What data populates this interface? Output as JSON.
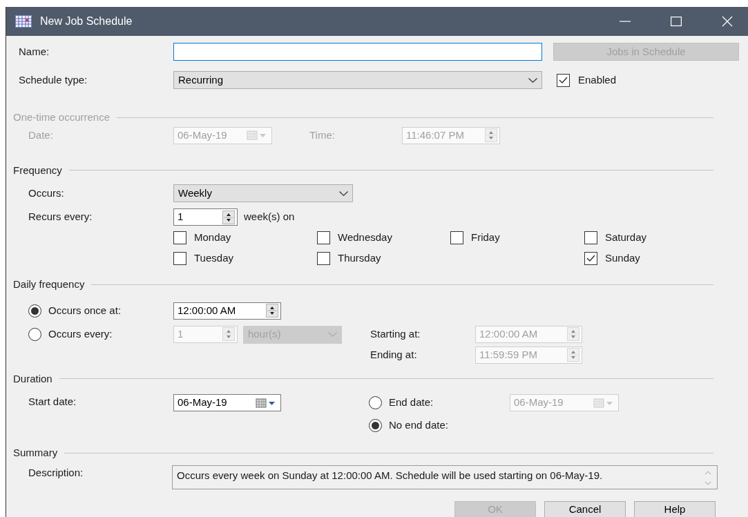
{
  "window": {
    "title": "New Job Schedule"
  },
  "name": {
    "label": "Name:"
  },
  "jobs_button": {
    "label": "Jobs in Schedule",
    "disabled": true
  },
  "schedule_type": {
    "label": "Schedule type:",
    "value": "Recurring"
  },
  "enabled": {
    "label": "Enabled",
    "checked": true
  },
  "one_time": {
    "title": "One-time occurrence",
    "disabled": true,
    "date_label": "Date:",
    "date": "06-May-19",
    "time_label": "Time:",
    "time": "11:46:07 PM"
  },
  "frequency": {
    "title": "Frequency",
    "occurs_label": "Occurs:",
    "occurs": "Weekly",
    "recurs_label": "Recurs every:",
    "recurs": "1",
    "unit": "week(s) on",
    "day_columns": [
      [
        {
          "label": "Monday",
          "checked": false
        },
        {
          "label": "Tuesday",
          "checked": false
        }
      ],
      [
        {
          "label": "Wednesday",
          "checked": false
        },
        {
          "label": "Thursday",
          "checked": false
        }
      ],
      [
        {
          "label": "Friday",
          "checked": false
        }
      ],
      [
        {
          "label": "Saturday",
          "checked": false
        },
        {
          "label": "Sunday",
          "checked": true
        }
      ]
    ]
  },
  "daily_frequency": {
    "title": "Daily frequency",
    "options": [
      {
        "kind": "once",
        "label": "Occurs once at:",
        "selected": true,
        "time": "12:00:00 AM"
      },
      {
        "kind": "every",
        "label": "Occurs every:",
        "selected": false,
        "interval": "1",
        "unit": "hour(s)",
        "start_label": "Starting at:",
        "start": "12:00:00 AM",
        "end_label": "Ending at:",
        "end": "11:59:59 PM"
      }
    ]
  },
  "duration": {
    "title": "Duration",
    "start_label": "Start date:",
    "start": "06-May-19",
    "end_options": [
      {
        "kind": "date",
        "label": "End date:",
        "selected": false,
        "date": "06-May-19"
      },
      {
        "kind": "none",
        "label": "No end date:",
        "selected": true
      }
    ]
  },
  "summary": {
    "title": "Summary",
    "description_label": "Description:",
    "description": "Occurs every week on Sunday at 12:00:00 AM. Schedule will be used starting on 06-May-19."
  },
  "buttons": [
    {
      "label": "OK",
      "disabled": true
    },
    {
      "label": "Cancel",
      "disabled": false
    },
    {
      "label": "Help",
      "disabled": false
    }
  ]
}
